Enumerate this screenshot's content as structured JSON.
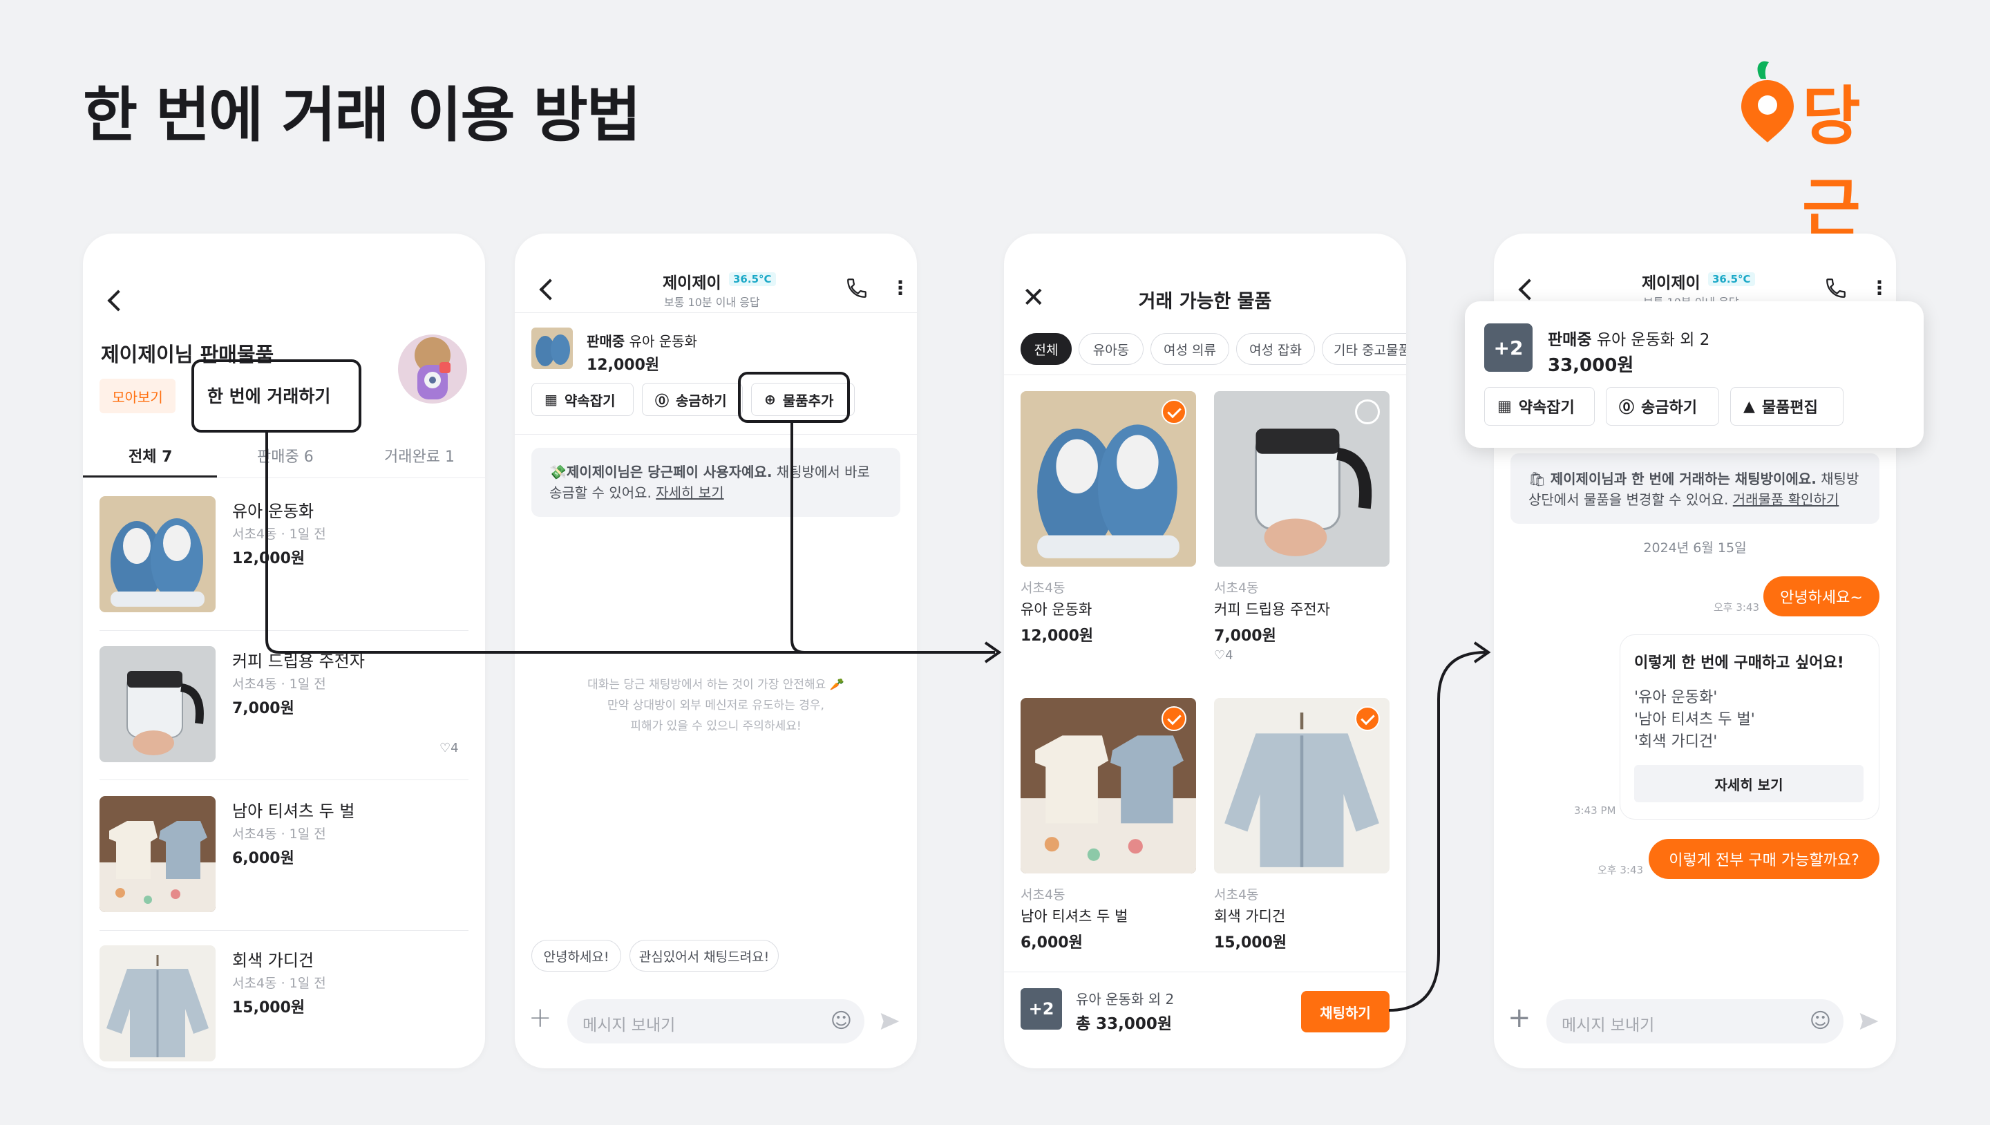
{
  "title": "한 번에 거래 이용 방법",
  "brand": {
    "name": "당근",
    "accent_color": "#ff6f0f"
  },
  "screen1": {
    "heading": "제이제이님 판매물품",
    "badge": "모아보기",
    "bundle_button": "한 번에 거래하기",
    "tabs": [
      "전체 7",
      "판매중 6",
      "거래완료 1"
    ],
    "items": [
      {
        "title": "유아 운동화",
        "meta": "서초4동 · 1일 전",
        "price": "12,000원"
      },
      {
        "title": "커피 드립용 주전자",
        "meta": "서초4동 · 1일 전",
        "price": "7,000원",
        "likes": "4"
      },
      {
        "title": "남아 티셔츠 두 벌",
        "meta": "서초4동 · 1일 전",
        "price": "6,000원"
      },
      {
        "title": "회색 가디건",
        "meta": "서초4동 · 1일 전",
        "price": "15,000원"
      }
    ]
  },
  "screen2": {
    "name": "제이제이",
    "temperature": "36.5°C",
    "response": "보통 10분 이내 응답",
    "status": "판매중",
    "product": "유아 운동화",
    "price": "12,000원",
    "actions": [
      "약속잡기",
      "송금하기",
      "물품추가"
    ],
    "notice_bold": "제이제이님은 당근페이 사용자예요.",
    "notice_text": " 채팅방에서 바로 송금할 수 있어요.",
    "notice_link": "자세히 보기",
    "safety_1": "대화는 당근 채팅방에서 하는 것이 가장 안전해요 🥕",
    "safety_2": "만약 상대방이 외부 메신저로 유도하는 경우,",
    "safety_3": "피해가 있을 수 있으니 주의하세요!",
    "quick_replies": [
      "안녕하세요!",
      "관심있어서 채팅드려요!"
    ],
    "input_placeholder": "메시지 보내기"
  },
  "screen3": {
    "title": "거래 가능한 물품",
    "filters": [
      "전체",
      "유아동",
      "여성 의류",
      "여성 잡화",
      "기타 중고물품"
    ],
    "items": [
      {
        "location": "서초4동",
        "title": "유아 운동화",
        "price": "12,000원",
        "selected": true
      },
      {
        "location": "서초4동",
        "title": "커피 드립용 주전자",
        "price": "7,000원",
        "likes": "4",
        "selected": false
      },
      {
        "location": "서초4동",
        "title": "남아 티셔츠 두 벌",
        "price": "6,000원",
        "selected": true
      },
      {
        "location": "서초4동",
        "title": "회색 가디건",
        "price": "15,000원",
        "selected": true
      }
    ],
    "summary_title": "유아 운동화 외 2",
    "summary_total": "총 33,000원",
    "summary_badge": "+2",
    "chat_button": "채팅하기"
  },
  "screen4": {
    "name": "제이제이",
    "temperature": "36.5°C",
    "response": "보통 10분 이내 응답",
    "status": "판매중",
    "product": "유아 운동화 외 2",
    "price": "33,000원",
    "badge": "+2",
    "actions": [
      "약속잡기",
      "송금하기",
      "물품편집"
    ],
    "notice_bold": "제이제이님과 한 번에 거래하는 채팅방이에요.",
    "notice_text": " 채팅방 상단에서 물품을 변경할 수 있어요.",
    "notice_link": "거래물품 확인하기",
    "date": "2024년 6월 15일",
    "msg1": "안녕하세요~",
    "msg1_time": "오후 3:43",
    "card_title": "이렇게 한 번에 구매하고 싶어요!",
    "card_items": [
      "'유아 운동화'",
      "'남아 티셔츠 두 벌'",
      "'회색 가디건'"
    ],
    "card_button": "자세히 보기",
    "card_time": "3:43 PM",
    "msg2": "이렇게 전부 구매 가능할까요?",
    "msg2_time": "오후 3:43",
    "input_placeholder": "메시지 보내기"
  }
}
